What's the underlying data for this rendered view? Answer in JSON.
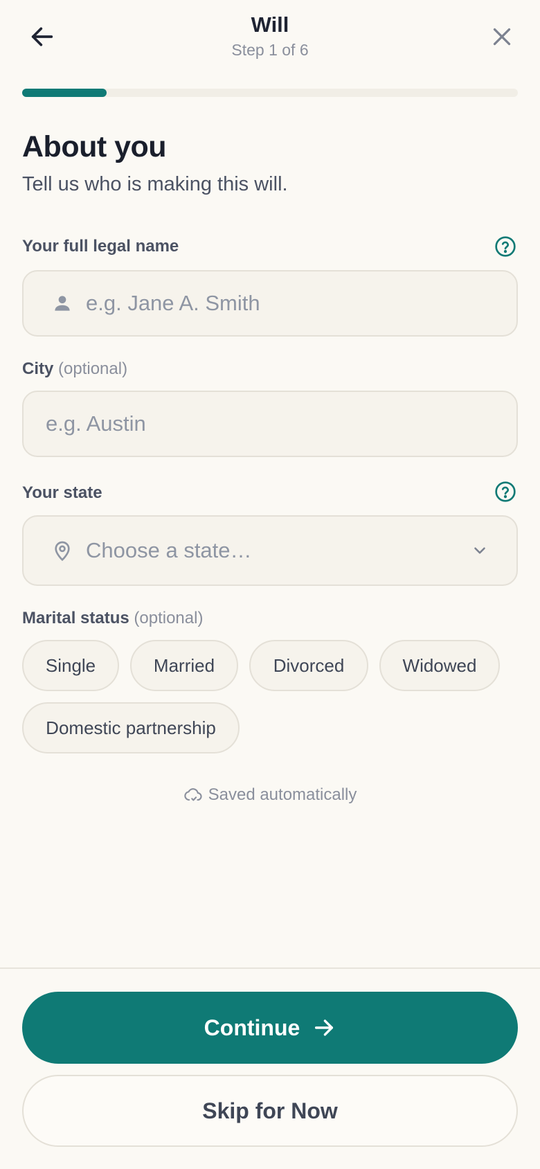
{
  "header": {
    "title": "Will",
    "step": "Step 1 of 6"
  },
  "progress": {
    "current_step": 1,
    "total_steps": 6,
    "fraction": 0.17,
    "color": "#0f7a75"
  },
  "page": {
    "heading": "About you",
    "lead": "Tell us who is making this will."
  },
  "fields": {
    "name": {
      "label": "Your full legal name",
      "placeholder": "e.g. Jane A. Smith",
      "icon": "person-icon"
    },
    "city": {
      "label": "City",
      "optional": "(optional)",
      "placeholder": "e.g. Austin"
    },
    "state": {
      "label": "Your state",
      "placeholder": "Choose a state…",
      "icon": "location-pin-icon"
    },
    "marital": {
      "label": "Marital status",
      "optional": "(optional)",
      "options": [
        "Single",
        "Married",
        "Divorced",
        "Widowed",
        "Domestic partnership"
      ]
    }
  },
  "status": {
    "saved": "Saved automatically"
  },
  "actions": {
    "continue": "Continue",
    "skip": "Skip for Now"
  },
  "colors": {
    "accent": "#0f7a75",
    "background": "#fbf9f4",
    "field_bg": "#f6f3ec"
  }
}
